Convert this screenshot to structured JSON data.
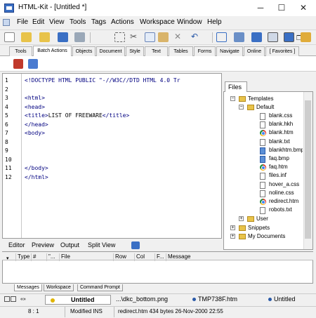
{
  "window": {
    "title": "HTML-Kit - [Untitled *]",
    "minimize": "─",
    "maximize": "☐",
    "close": "✕"
  },
  "menu": [
    "File",
    "Edit",
    "View",
    "Tools",
    "Tags",
    "Actions",
    "Workspace",
    "Window",
    "Help"
  ],
  "toolbar_icons": [
    "new-file-icon",
    "open-icon",
    "open-recent-icon",
    "save-icon",
    "print-icon",
    "select-icon",
    "cut-icon",
    "copy-icon",
    "paste-icon",
    "delete-icon",
    "undo-icon",
    "panel-icon",
    "tree-icon",
    "zoom-icon",
    "preview-icon",
    "browser-icon",
    "html-icon",
    "options-icon"
  ],
  "plugin_tabs": [
    "Tools",
    "Batch Actions",
    "Objects",
    "Document",
    "Style",
    "Text",
    "Tables",
    "Forms",
    "Navigate",
    "Online",
    "[ Favorites ]"
  ],
  "active_plugin_tab": "Batch Actions",
  "editor": {
    "line_numbers": [
      "1",
      "2",
      "3",
      "4",
      "5",
      "6",
      "7",
      "8",
      "9",
      "10",
      "11",
      "12"
    ],
    "lines": [
      {
        "pre": "<!DOCTYPE HTML PUBLIC \"-//W3C//DTD HTML 4.0 Tr",
        "text": "",
        "post": ""
      },
      {
        "pre": "",
        "text": "",
        "post": ""
      },
      {
        "pre": "<html>",
        "text": "",
        "post": ""
      },
      {
        "pre": "<head>",
        "text": "",
        "post": ""
      },
      {
        "pre": "<title>",
        "text": "LIST OF FREEWARE",
        "post": "</title>"
      },
      {
        "pre": "</head>",
        "text": "",
        "post": ""
      },
      {
        "pre": "<body>",
        "text": "",
        "post": ""
      },
      {
        "pre": "",
        "text": "",
        "post": ""
      },
      {
        "pre": "",
        "text": "",
        "post": ""
      },
      {
        "pre": "",
        "text": "",
        "post": ""
      },
      {
        "pre": "</body>",
        "text": "",
        "post": ""
      },
      {
        "pre": "</html>",
        "text": "",
        "post": ""
      }
    ]
  },
  "files_panel": {
    "tab": "Files",
    "tree": {
      "templates": "Templates",
      "default": "Default",
      "files": [
        {
          "name": "blank.css",
          "icon": "file"
        },
        {
          "name": "blank.hkh",
          "icon": "file"
        },
        {
          "name": "blank.htm",
          "icon": "chrome"
        },
        {
          "name": "blank.txt",
          "icon": "file"
        },
        {
          "name": "blankhtm.bmp",
          "icon": "image"
        },
        {
          "name": "faq.bmp",
          "icon": "image"
        },
        {
          "name": "faq.htm",
          "icon": "chrome"
        },
        {
          "name": "files.inf",
          "icon": "file"
        },
        {
          "name": "hover_a.css",
          "icon": "file"
        },
        {
          "name": "noline.css",
          "icon": "file"
        },
        {
          "name": "redirect.htm",
          "icon": "chrome"
        },
        {
          "name": "robots.txt",
          "icon": "file"
        }
      ],
      "user": "User",
      "snippets": "Snippets",
      "my_documents": "My Documents"
    }
  },
  "editor_tabs": [
    "Editor",
    "Preview",
    "Output",
    "Split View"
  ],
  "messages": {
    "columns": [
      "Type",
      "#",
      "\"...",
      "File",
      "Row",
      "Col",
      "F...",
      "Message"
    ]
  },
  "message_tabs": [
    "Messages",
    "Workspace",
    "Command Prompt"
  ],
  "doc_tabs": [
    "Untitled",
    "...\\dkc_bottom.png",
    "TMP738F.htm",
    "Untitled"
  ],
  "status": {
    "position": "8 : 1",
    "mode": "Modified INS",
    "file_info": "redirect.htm  434 bytes  26-Nov-2000 22:55"
  }
}
